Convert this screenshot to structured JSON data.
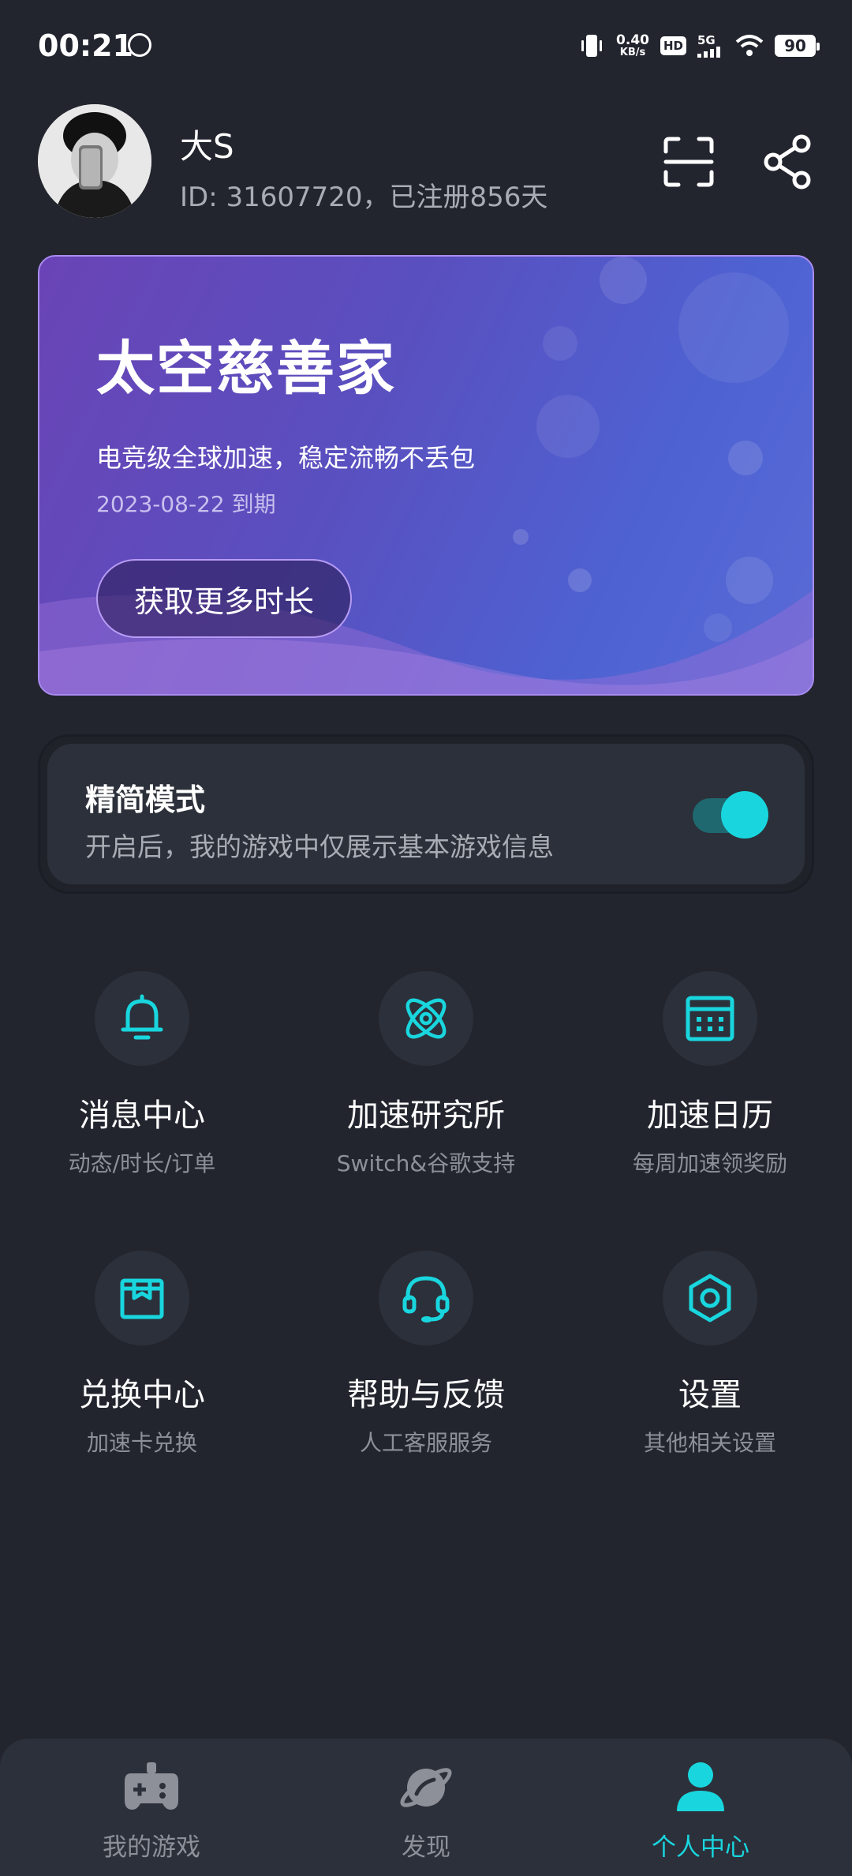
{
  "status_bar": {
    "time": "00:21",
    "net_speed_value": "0.40",
    "net_speed_unit": "KB/s",
    "hd_badge": "HD",
    "network": "5G",
    "battery": "90"
  },
  "profile": {
    "name": "大S",
    "id_line": "ID: 31607720，已注册856天"
  },
  "banner": {
    "title": "太空慈善家",
    "subtitle": "电竞级全球加速，稳定流畅不丢包",
    "expire": "2023-08-22 到期",
    "button": "获取更多时长"
  },
  "simple_mode": {
    "title": "精简模式",
    "description": "开启后，我的游戏中仅展示基本游戏信息",
    "enabled": true
  },
  "grid": [
    {
      "label": "消息中心",
      "sub": "动态/时长/订单",
      "icon": "bell-icon"
    },
    {
      "label": "加速研究所",
      "sub": "Switch&谷歌支持",
      "icon": "atom-icon"
    },
    {
      "label": "加速日历",
      "sub": "每周加速领奖励",
      "icon": "calendar-icon"
    },
    {
      "label": "兑换中心",
      "sub": "加速卡兑换",
      "icon": "gift-box-icon"
    },
    {
      "label": "帮助与反馈",
      "sub": "人工客服服务",
      "icon": "headset-icon"
    },
    {
      "label": "设置",
      "sub": "其他相关设置",
      "icon": "hex-nut-icon"
    }
  ],
  "bottom_nav": [
    {
      "label": "我的游戏",
      "icon": "gamepad-icon",
      "active": false
    },
    {
      "label": "发现",
      "icon": "planet-icon",
      "active": false
    },
    {
      "label": "个人中心",
      "icon": "person-icon",
      "active": true
    }
  ],
  "colors": {
    "background": "#22252e",
    "card": "#2c303a",
    "accent": "#19d6de",
    "banner_border": "#a98bf0"
  }
}
